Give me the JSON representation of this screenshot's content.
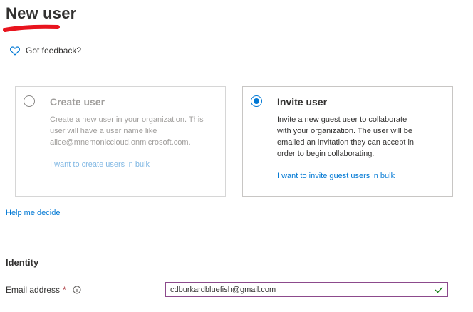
{
  "page": {
    "title": "New user",
    "feedback_label": "Got feedback?"
  },
  "options": {
    "create": {
      "title": "Create user",
      "description": "Create a new user in your organization. This user will have a user name like alice@mnemoniccloud.onmicrosoft.com.",
      "link": "I want to create users in bulk",
      "selected": false
    },
    "invite": {
      "title": "Invite user",
      "description": "Invite a new guest user to collaborate with your organization. The user will be emailed an invitation they can accept in order to begin collaborating.",
      "link": "I want to invite guest users in bulk",
      "selected": true
    }
  },
  "help_link": "Help me decide",
  "identity": {
    "heading": "Identity",
    "email_label": "Email address",
    "required_marker": "*",
    "email_value": "cdburkardbluefish@gmail.com"
  },
  "colors": {
    "accent": "#0078d4",
    "annotation_stroke": "#e8141e",
    "input_border": "#8c4a8c",
    "valid_check": "#107c10"
  },
  "icons": {
    "feedback": "heart-icon",
    "info": "info-icon",
    "valid": "checkmark-icon"
  }
}
